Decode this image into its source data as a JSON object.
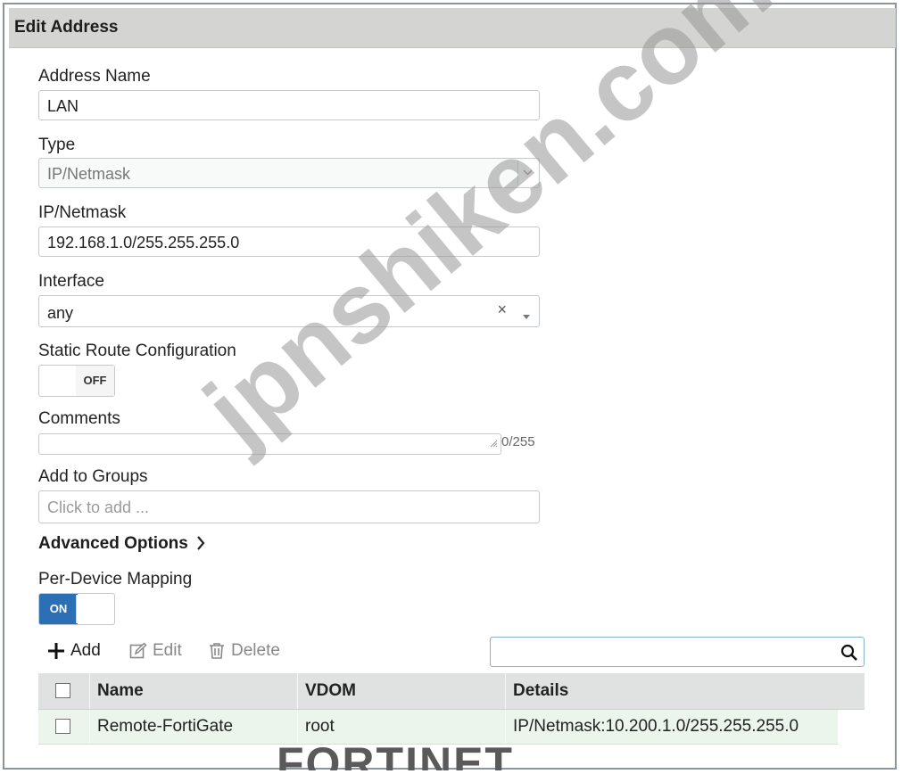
{
  "dialog": {
    "title": "Edit Address"
  },
  "address_name": {
    "label": "Address Name",
    "value": "LAN"
  },
  "type": {
    "label": "Type",
    "value": "IP/Netmask"
  },
  "ip_netmask": {
    "label": "IP/Netmask",
    "value": "192.168.1.0/255.255.255.0"
  },
  "interface": {
    "label": "Interface",
    "value": "any",
    "clear_glyph": "×"
  },
  "static_route": {
    "label": "Static Route Configuration",
    "state": "OFF"
  },
  "comments": {
    "label": "Comments",
    "value": "",
    "counter": "0/255"
  },
  "add_to_groups": {
    "label": "Add to Groups",
    "placeholder": "Click to add ..."
  },
  "advanced_options": {
    "label": "Advanced Options"
  },
  "per_device_mapping": {
    "label": "Per-Device Mapping",
    "state": "ON"
  },
  "toolbar": {
    "add": "Add",
    "edit": "Edit",
    "delete": "Delete",
    "search_value": ""
  },
  "table": {
    "columns": [
      "Name",
      "VDOM",
      "Details"
    ],
    "rows": [
      {
        "name": "Remote-FortiGate",
        "vdom": "root",
        "details": "IP/Netmask:10.200.1.0/255.255.255.0"
      }
    ]
  },
  "watermark": "jpnshiken.com",
  "logo": "FORTINET",
  "colors": {
    "toggle_on": "#2d6fb4",
    "header_bg": "#d4d5d3",
    "row_bg": "#ebf5ec"
  }
}
